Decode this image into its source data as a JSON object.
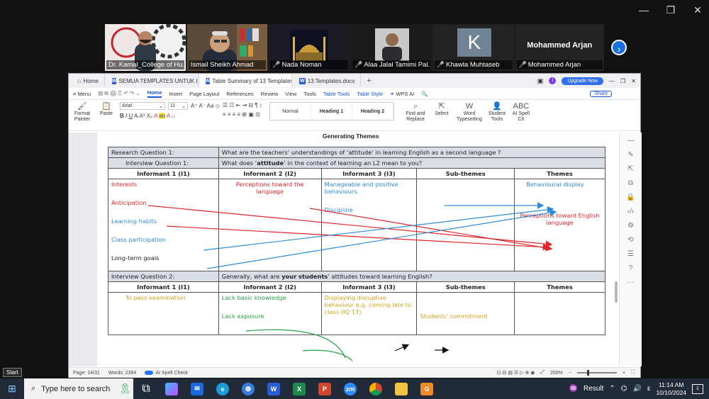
{
  "zoom_window": {
    "controls": [
      "—",
      "❐",
      "✕"
    ]
  },
  "participants": [
    {
      "name": "Dr. Kamal_College of Hu...",
      "muted": false,
      "active": false
    },
    {
      "name": "Ismail Sheikh Ahmad",
      "muted": false,
      "active": true
    },
    {
      "name": "Nada Noman",
      "muted": true,
      "active": false
    },
    {
      "name": "Alaa Jalal Tamimi Pal...",
      "muted": true,
      "active": false
    },
    {
      "name": "Khawla Muhtaseb",
      "muted": true,
      "active": false,
      "initial": "K"
    },
    {
      "name": "Mohammed Arjan",
      "muted": true,
      "active": false,
      "big_name": "Mohammed Arjan"
    }
  ],
  "wps": {
    "tabs": [
      {
        "label": "Home",
        "icon": "home-icon"
      },
      {
        "label": "SEMUA TEMPLATES UNTUK IE",
        "icon": "word-doc-icon"
      },
      {
        "label": "Table Summary of 13 Templates.docx",
        "icon": "word-doc-icon"
      },
      {
        "label": "13 Templates.docx",
        "icon": "word-doc-icon"
      }
    ],
    "new_tab": "+",
    "upgrade": "Upgrade Now",
    "menu": [
      "Menu",
      "Home",
      "Insert",
      "Page Layout",
      "References",
      "Review",
      "View",
      "Tools",
      "Table Tools",
      "Table Style",
      "WPS AI"
    ],
    "share": "Share",
    "ribbon": {
      "format_painter": "Format Painter",
      "paste": "Paste",
      "font": "Arial",
      "size": "11",
      "styles": [
        "Normal",
        "Heading 1",
        "Heading 2"
      ],
      "find": "Find and Replace",
      "select": "Select",
      "word_typesetting": "Word Typesetting",
      "student_tools": "Student Tools",
      "ai_spell": "AI Spell Ch"
    },
    "document": {
      "title": "Generating Themes",
      "rq_label": "Research Question 1:",
      "rq_text": "What are the teachers’ understandings of ‘attitude’ in learning English as a second language ?",
      "iq1_label": "Interview Question 1:",
      "iq1_text_a": "What does ‘",
      "iq1_text_b": "attitude",
      "iq1_text_c": "’ in the context of learning an L2 mean to you?",
      "headers": [
        "Informant 1 (I1)",
        "Informant 2 (I2)",
        "Informant 3 (I3)",
        "Sub-themes",
        "Themes"
      ],
      "i1_items": [
        "Interests",
        "Anticipation",
        "Learning habits",
        "Class participation",
        "Long-term goals"
      ],
      "i2_items": [
        "Perceptions toward the language"
      ],
      "i3_items": [
        "Manageable and positive behaviours.",
        "Discipline"
      ],
      "themes": [
        "Behavioural display",
        "Perceptions toward English language"
      ],
      "iq2_label": "Interview Question 2:",
      "iq2_text_a": "Generally, what are ",
      "iq2_text_b": "your students",
      "iq2_text_c": "’ attitudes toward learning English?",
      "q2_i1": [
        "To pass examination"
      ],
      "q2_i2": [
        "Lack basic knowledge",
        "Lack exposure"
      ],
      "q2_i3": "Displaying disruptive behaviour e.g. coming late to class",
      "q2_i3_ref": "(IQ 13)",
      "q2_sub": "Students’ commitment"
    },
    "status": {
      "page": "Page: 14/31",
      "words": "Words: 2394",
      "spell": "AI Spell Check",
      "zoom": "200%"
    }
  },
  "taskbar": {
    "start_tip": "Start",
    "search_placeholder": "Type here to search",
    "apps": [
      "task-view",
      "copilot",
      "mail",
      "edge",
      "browser",
      "word",
      "excel",
      "powerpoint",
      "zoom",
      "chrome",
      "explorer",
      "wps"
    ],
    "result": "Result",
    "time": "11:14 AM",
    "date": "10/10/2024",
    "notif_count": "1"
  },
  "colors": {
    "red_text": "#e0262b",
    "blue_text": "#2e8bd8",
    "gold_text": "#d3a219",
    "green_arrow": "#27a043",
    "accent": "#2f6ff0"
  }
}
